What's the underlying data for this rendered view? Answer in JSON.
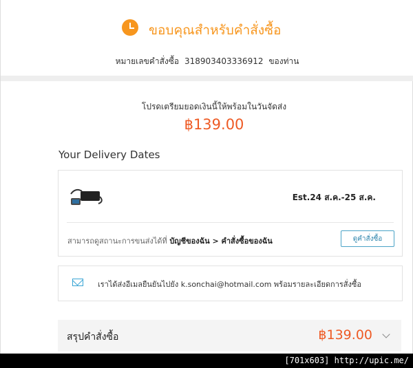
{
  "header": {
    "title": "ขอบคุณสำหรับคำสั่งซื้อ",
    "order_label": "หมายเลขคำสั่งซื้อ",
    "order_number": "318903403336912",
    "order_suffix": "ของท่าน"
  },
  "payment": {
    "instruction": "โปรดเตรียมยอดเงินนี้ให้พร้อมในวันจัดส่ง",
    "amount": "฿139.00"
  },
  "delivery": {
    "title": "Your Delivery Dates",
    "estimate": "Est.24 ส.ค.-25 ส.ค.",
    "track_prefix": "สามารถดูสถานะการขนส่งได้ที่",
    "track_link": "บัญชีของฉัน > คำสั่งซื้อของฉัน",
    "view_order_button": "ดูคำสั่งซื้อ",
    "product_icon": "product-thumbnail-cable"
  },
  "email_notice": {
    "icon": "mail-icon",
    "text": "เราได้ส่งอีเมลยืนยันไปยัง k.sonchai@hotmail.com พร้อมรายละเอียดการสั่งซื้อ"
  },
  "summary": {
    "label": "สรุปคำสั่งซื้อ",
    "amount": "฿139.00"
  },
  "watermark": "[701x603] http://upic.me/",
  "colors": {
    "accent": "#f7961e",
    "price": "#ee5a24",
    "link_button": "#4aa3c7",
    "mail_icon": "#38a4d4"
  }
}
